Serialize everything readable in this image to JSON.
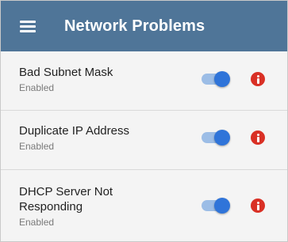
{
  "app_bar": {
    "menu_icon": "hamburger-menu-icon",
    "title": "Network Problems",
    "background_color": "#4f7598"
  },
  "problems": [
    {
      "title": "Bad Subnet Mask",
      "status": "Enabled",
      "enabled": true,
      "info_icon": "info-icon"
    },
    {
      "title": "Duplicate IP Address",
      "status": "Enabled",
      "enabled": true,
      "info_icon": "info-icon"
    },
    {
      "title": "DHCP Server Not Responding",
      "status": "Enabled",
      "enabled": true,
      "info_icon": "info-icon"
    }
  ],
  "colors": {
    "toggle_on": "#2f74d9",
    "toggle_track_on": "#9cbde6",
    "info_badge": "#d93025"
  }
}
